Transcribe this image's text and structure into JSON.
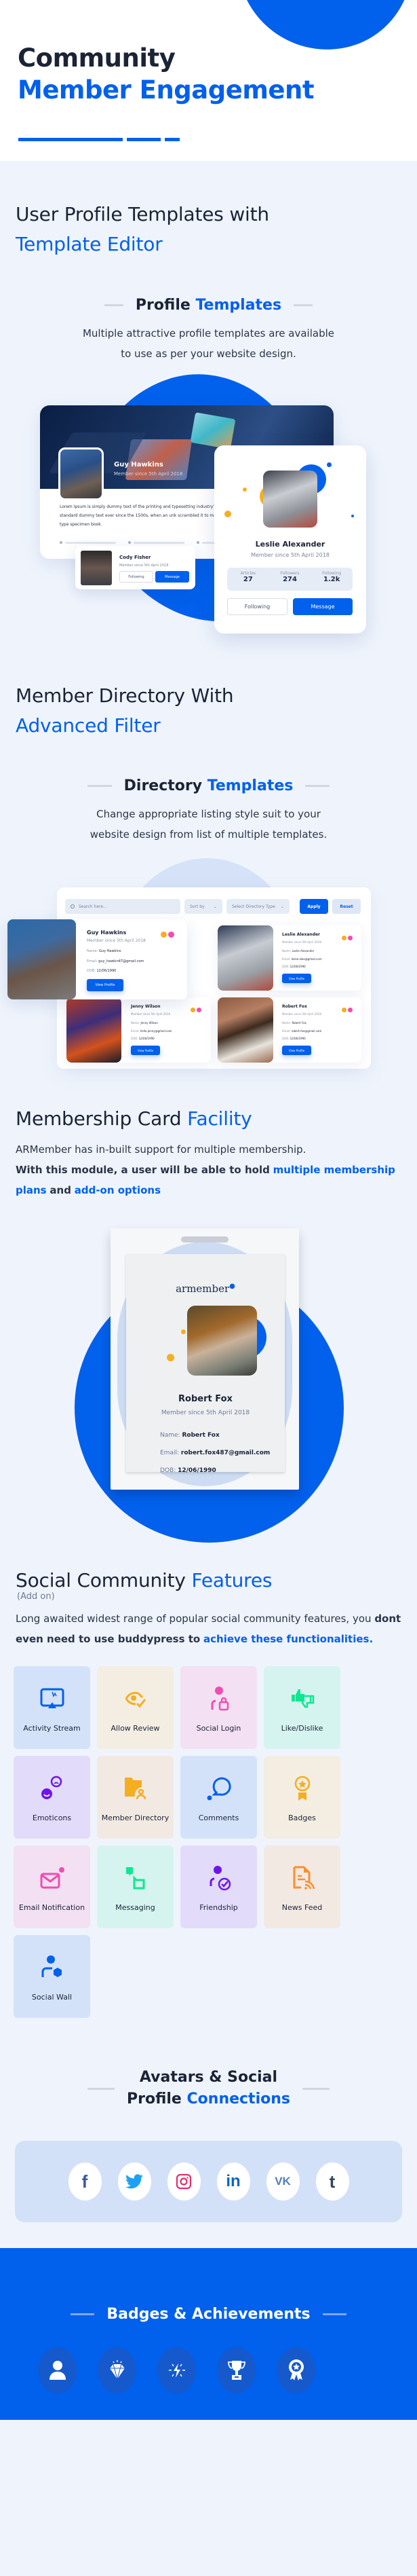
{
  "colors": {
    "accent": "#0160ec",
    "dark": "#1b2336",
    "background": "#eff4fc"
  },
  "hero": {
    "title_line1": "Community",
    "title_line2": "Member Engagement"
  },
  "profile_section": {
    "heading_dark": "User Profile Templates with",
    "heading_blue": "Template Editor",
    "sub_dark": "Profile",
    "sub_blue": "Templates",
    "desc_line1": "Multiple attractive profile templates are available",
    "desc_line2": "to use as per your website design.",
    "cover_card": {
      "name": "Guy Hawkins",
      "since": "Member since 5th April 2018",
      "bio": "Lorem Ipsum is simply dummy text of the printing and typesetting industry's standard dummy text ever since the 1500s, when an unk scrambled it to make a type specimen book."
    },
    "mini_card": {
      "name": "Cody Fisher",
      "since": "Member since 5th April 2018",
      "following_label": "Following",
      "message_label": "Message"
    },
    "main_card": {
      "name": "Leslie Alexander",
      "since": "Member since 5th April 2018",
      "stats": [
        {
          "label": "Articles",
          "value": "27"
        },
        {
          "label": "Followers",
          "value": "274"
        },
        {
          "label": "Following",
          "value": "1.2k"
        }
      ],
      "following_label": "Following",
      "message_label": "Message"
    }
  },
  "directory_section": {
    "heading_dark": "Member Directory With",
    "heading_blue": "Advanced Filter",
    "sub_dark": "Directory",
    "sub_blue": "Templates",
    "desc_line1": "Change appropriate listing style suit to your",
    "desc_line2": "website design from list of multiple templates.",
    "search_placeholder": "Search here...",
    "sort_label": "Sort by",
    "type_label": "Select Directory Type",
    "apply_label": "Apply",
    "reset_label": "Reset",
    "name_key": "Name:",
    "email_key": "Email:",
    "dob_key": "DOB:",
    "view_label": "View Profile",
    "members": [
      {
        "name": "Guy Hawkins",
        "since": "Member since 5th April 2018",
        "full_name": "Guy Hawkins",
        "email": "guy_hawkin47@gmail.com",
        "dob": "12/06/1990"
      },
      {
        "name": "Leslie Alexander",
        "since": "Member since 5th April 2018",
        "full_name": "Leslie Alexander",
        "email": "leslie.alex@gmail.com",
        "dob": "12/06/1990"
      },
      {
        "name": "Jenny Wilson",
        "since": "Member since 5th April 2018",
        "full_name": "Jenny Wilson",
        "email": "hello.jenny@gmail.com",
        "dob": "12/06/1990"
      },
      {
        "name": "Robert Fox",
        "since": "Member since 5th April 2018",
        "full_name": "Robert Fox",
        "email": "robert.fox@gmail.com",
        "dob": "12/06/1990"
      }
    ]
  },
  "membership_section": {
    "heading_dark": "Membership Card",
    "heading_blue": "Facility",
    "desc_plain": "ARMember has in-built support for multiple membership.",
    "desc_bold": "With this module, a user will be able to hold",
    "desc_blue1": "multiple membership plans",
    "desc_and": "and",
    "desc_blue2": "add-on options",
    "card": {
      "logo": "armember",
      "name": "Robert Fox",
      "since": "Member since 5th April 2018",
      "name_key": "Name:",
      "name_val": "Robert Fox",
      "email_key": "Email:",
      "email_val": "robert.fox487@gmail.com",
      "dob_key": "DOB:",
      "dob_val": "12/06/1990"
    }
  },
  "social_section": {
    "heading_dark": "Social Community",
    "heading_blue": "Features",
    "addon": "(Add on)",
    "desc_plain": "Long awaited widest range of popular social community features, you",
    "desc_bold": "dont even need to use buddypress to",
    "desc_blue": "achieve these functionalities.",
    "features": [
      {
        "label": "Activity Stream",
        "icon": "activity-stream-icon",
        "bg": "#d4e2f9",
        "fg": "#0160ec"
      },
      {
        "label": "Allow Review",
        "icon": "review-eye-icon",
        "bg": "#f3ede2",
        "fg": "#f4ae21"
      },
      {
        "label": "Social Login",
        "icon": "user-lock-icon",
        "bg": "#f3e0f3",
        "fg": "#f24cb0"
      },
      {
        "label": "Like/Dislike",
        "icon": "thumbs-icon",
        "bg": "#d6f4ef",
        "fg": "#0ee88f"
      },
      {
        "label": "Emoticons",
        "icon": "emoticons-icon",
        "bg": "#e2dbfa",
        "fg": "#6e16ea"
      },
      {
        "label": "Member Directory",
        "icon": "folder-user-icon",
        "bg": "#f3e9e3",
        "fg": "#f4ae21"
      },
      {
        "label": "Comments",
        "icon": "comment-icon",
        "bg": "#d4e2f9",
        "fg": "#0160ec"
      },
      {
        "label": "Badges",
        "icon": "badge-icon",
        "bg": "#f3ede2",
        "fg": "#f4ae21"
      },
      {
        "label": "Email Notification",
        "icon": "email-icon",
        "bg": "#f3e0f3",
        "fg": "#f24cb0"
      },
      {
        "label": "Messaging",
        "icon": "messaging-icon",
        "bg": "#d6f4ef",
        "fg": "#0ee88f"
      },
      {
        "label": "Friendship",
        "icon": "friendship-icon",
        "bg": "#e2dbfa",
        "fg": "#6e16ea"
      },
      {
        "label": "News Feed",
        "icon": "news-feed-icon",
        "bg": "#f3e9e3",
        "fg": "#fb8f2e"
      },
      {
        "label": "Social Wall",
        "icon": "social-wall-icon",
        "bg": "#d4e2f9",
        "fg": "#0160ec"
      }
    ]
  },
  "avatars_section": {
    "heading_line1": "Avatars & Social",
    "heading_dark": "Profile",
    "heading_blue": "Connections",
    "networks": [
      {
        "name": "facebook",
        "glyph": "f",
        "color": "#3b5998"
      },
      {
        "name": "twitter",
        "glyph": "t",
        "color": "#1da1f2"
      },
      {
        "name": "instagram",
        "glyph": "ig",
        "color": "#e1306c"
      },
      {
        "name": "linkedin",
        "glyph": "in",
        "color": "#0a66c2"
      },
      {
        "name": "vk",
        "glyph": "vk",
        "color": "#5181b8"
      },
      {
        "name": "tumblr",
        "glyph": "t",
        "color": "#34465d"
      }
    ]
  },
  "badges_section": {
    "heading": "Badges & Achievements",
    "badges": [
      "user-badge-icon",
      "diamond-icon",
      "lightning-icon",
      "trophy-icon",
      "award-ribbon-icon"
    ]
  }
}
